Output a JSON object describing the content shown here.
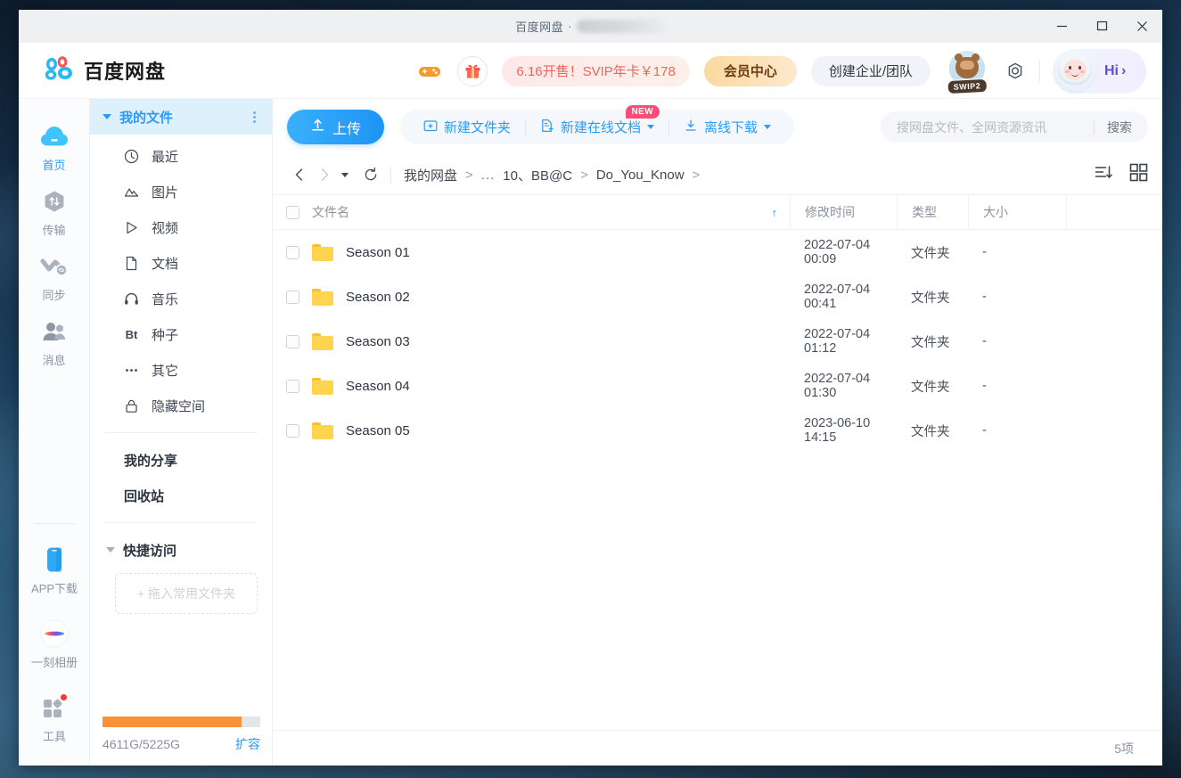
{
  "window": {
    "title_app": "百度网盘",
    "title_sep": "·",
    "min_label": "—",
    "max_label": "▢",
    "close_label": "✕"
  },
  "header": {
    "brand": "百度网盘",
    "game_icon": "gamepad-icon",
    "gift_icon": "gift-icon",
    "promo_text": "6.16开售！SVIP年卡￥178",
    "vip_center": "会员中心",
    "create_team": "创建企业/团队",
    "swip_badge": "SWIP2",
    "gear_icon": "gear-icon",
    "greeting": "Hi",
    "greeting_arrow": "›"
  },
  "rail": {
    "items": [
      {
        "label": "首页",
        "icon": "cloud-icon",
        "active": true,
        "badge": false
      },
      {
        "label": "传输",
        "icon": "transfer-icon",
        "active": false,
        "badge": false
      },
      {
        "label": "同步",
        "icon": "sync-icon",
        "active": false,
        "badge": false
      },
      {
        "label": "消息",
        "icon": "message-icon",
        "active": false,
        "badge": false
      }
    ],
    "bottom_items": [
      {
        "label": "APP下载",
        "icon": "phone-icon",
        "badge": false
      },
      {
        "label": "一刻相册",
        "icon": "album-icon",
        "badge": false
      },
      {
        "label": "工具",
        "icon": "tools-icon",
        "badge": true
      }
    ]
  },
  "tree": {
    "header": "我的文件",
    "items": [
      {
        "label": "最近",
        "icon": "clock-icon"
      },
      {
        "label": "图片",
        "icon": "image-icon"
      },
      {
        "label": "视频",
        "icon": "video-icon"
      },
      {
        "label": "文档",
        "icon": "document-icon"
      },
      {
        "label": "音乐",
        "icon": "music-icon"
      },
      {
        "label": "种子",
        "icon": "bt-icon"
      },
      {
        "label": "其它",
        "icon": "ellipsis-icon"
      },
      {
        "label": "隐藏空间",
        "icon": "lock-icon"
      }
    ],
    "plain_items": [
      {
        "label": "我的分享"
      },
      {
        "label": "回收站"
      }
    ],
    "quick_access_label": "快捷访问",
    "dropzone_text": "+ 拖入常用文件夹",
    "storage_text": "4611G/5225G",
    "storage_link": "扩容",
    "storage_percent": 88
  },
  "toolbar": {
    "upload_label": "上传",
    "new_folder_label": "新建文件夹",
    "new_doc_label": "新建在线文档",
    "new_doc_badge": "NEW",
    "offline_download_label": "离线下载"
  },
  "search": {
    "placeholder": "搜网盘文件、全网资源资讯",
    "value": "",
    "button_label": "搜索"
  },
  "breadcrumb": {
    "back_icon": "chevron-left-icon",
    "forward_icon": "chevron-right-icon",
    "history_icon": "caret-down-icon",
    "refresh_icon": "refresh-icon",
    "root": "我的网盘",
    "ellipsis": "...",
    "items": [
      {
        "label": "10、BB@C"
      },
      {
        "label": "Do_You_Know"
      }
    ],
    "separator": ">"
  },
  "view_tools": {
    "sort_icon": "sort-descending-icon",
    "grid_icon": "grid-view-icon"
  },
  "table": {
    "columns": {
      "name": "文件名",
      "mtime": "修改时间",
      "type": "类型",
      "size": "大小"
    },
    "sort_indicator": "↑",
    "rows": [
      {
        "name": "Season 01",
        "mtime": "2022-07-04 00:09",
        "type": "文件夹",
        "size": "-"
      },
      {
        "name": "Season 02",
        "mtime": "2022-07-04 00:41",
        "type": "文件夹",
        "size": "-"
      },
      {
        "name": "Season 03",
        "mtime": "2022-07-04 01:12",
        "type": "文件夹",
        "size": "-"
      },
      {
        "name": "Season 04",
        "mtime": "2022-07-04 01:30",
        "type": "文件夹",
        "size": "-"
      },
      {
        "name": "Season 05",
        "mtime": "2023-06-10 14:15",
        "type": "文件夹",
        "size": "-"
      }
    ]
  },
  "footer": {
    "count_label": "5项"
  },
  "colors": {
    "accent_blue": "#2a9bf7",
    "folder_yellow": "#ffd54f",
    "storage_orange": "#f99136",
    "promo_red": "#f4645a",
    "badge_pink": "#fb4b77"
  }
}
